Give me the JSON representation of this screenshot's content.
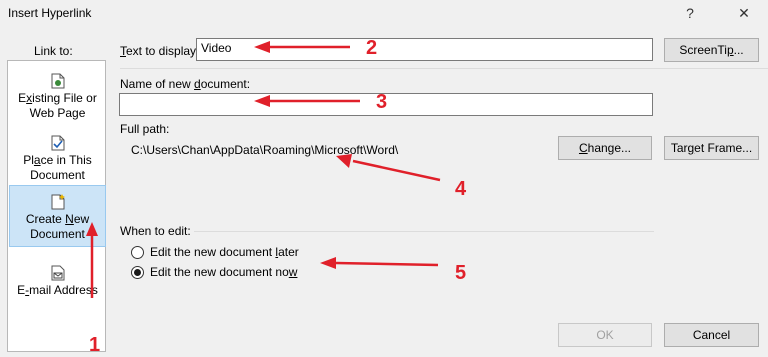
{
  "window": {
    "title": "Insert Hyperlink",
    "help_label": "?",
    "close_label": "✕"
  },
  "sidebar": {
    "header": "Link to:",
    "items": [
      {
        "line1_pre": "",
        "line1_u": "x",
        "line1_post": "",
        "line1_full_pre": "E",
        "line1_full_post": "isting File or",
        "line2": "Web Page",
        "icon": "file-globe-icon"
      },
      {
        "line1_pre": "Pl",
        "line1_u": "a",
        "line1_post": "ce in This",
        "line2": "Document",
        "icon": "document-place-icon"
      },
      {
        "line1_pre": "Create ",
        "line1_u": "N",
        "line1_post": "ew",
        "line2": "Document",
        "icon": "new-document-icon"
      },
      {
        "line1_pre": "E",
        "line1_u": "-",
        "line1_post": "mail Address",
        "line2": "",
        "icon": "email-icon"
      }
    ]
  },
  "form": {
    "text_to_display_pre": "",
    "text_to_display_u": "T",
    "text_to_display_post": "ext to display:",
    "text_to_display_value": "Video",
    "screentip_pre": "ScreenTi",
    "screentip_u": "p",
    "screentip_post": "...",
    "name_label_pre": "Name of new ",
    "name_label_u": "d",
    "name_label_post": "ocument:",
    "name_value": "",
    "full_path_label": "Full path:",
    "full_path_value": "C:\\Users\\Chan\\AppData\\Roaming\\Microsoft\\Word\\",
    "change_pre": "",
    "change_u": "C",
    "change_post": "hange...",
    "target_frame_pre": "Tar",
    "target_frame_u": "g",
    "target_frame_post": "et Frame...",
    "when_to_edit_label": "When to edit:",
    "radio_later_pre": "Edit the new document ",
    "radio_later_u": "l",
    "radio_later_post": "ater",
    "radio_now_pre": "Edit the new document no",
    "radio_now_u": "w",
    "radio_now_post": "",
    "selected_radio": "now",
    "ok_label": "OK",
    "cancel_label": "Cancel"
  },
  "annotations": {
    "n1": "1",
    "n2": "2",
    "n3": "3",
    "n4": "4",
    "n5": "5",
    "color": "#e0202a"
  }
}
